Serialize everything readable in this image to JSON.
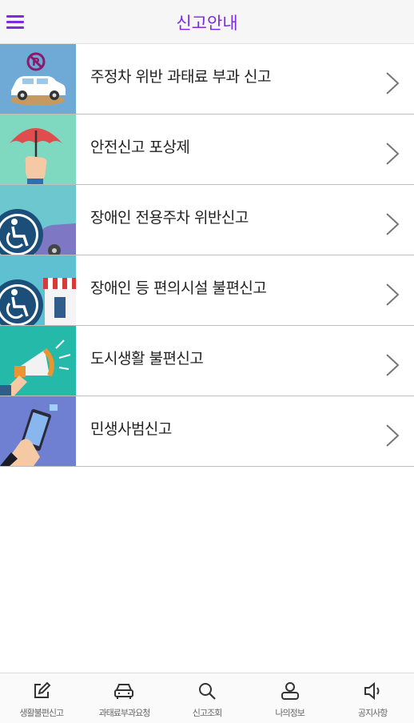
{
  "header": {
    "title": "신고안내",
    "menu_icon": "hamburger-menu-icon",
    "accent_color": "#7b2be2"
  },
  "items": [
    {
      "label": "주정차 위반 과태료 부과 신고",
      "image": "no-parking-car-illustration",
      "thumb_color": "#6fa9d6"
    },
    {
      "label": "안전신고 포상제",
      "image": "hand-holding-umbrella-illustration",
      "thumb_color": "#7fd8c0"
    },
    {
      "label": "장애인 전용주차 위반신고",
      "image": "wheelchair-parking-car-illustration",
      "thumb_color": "#6cc7cf"
    },
    {
      "label": "장애인 등 편의시설 불편신고",
      "image": "wheelchair-store-illustration",
      "thumb_color": "#5fc0d2"
    },
    {
      "label": "도시생활 불편신고",
      "image": "megaphone-illustration",
      "thumb_color": "#24b9a8"
    },
    {
      "label": "민생사범신고",
      "image": "hand-smartphone-illustration",
      "thumb_color": "#6f7fd2"
    }
  ],
  "tabbar": {
    "tabs": [
      {
        "label": "생활불편신고",
        "icon": "edit-icon"
      },
      {
        "label": "과태료부과요청",
        "icon": "car-icon"
      },
      {
        "label": "신고조회",
        "icon": "search-icon"
      },
      {
        "label": "나의정보",
        "icon": "user-icon"
      },
      {
        "label": "공지사항",
        "icon": "speaker-icon"
      }
    ]
  }
}
